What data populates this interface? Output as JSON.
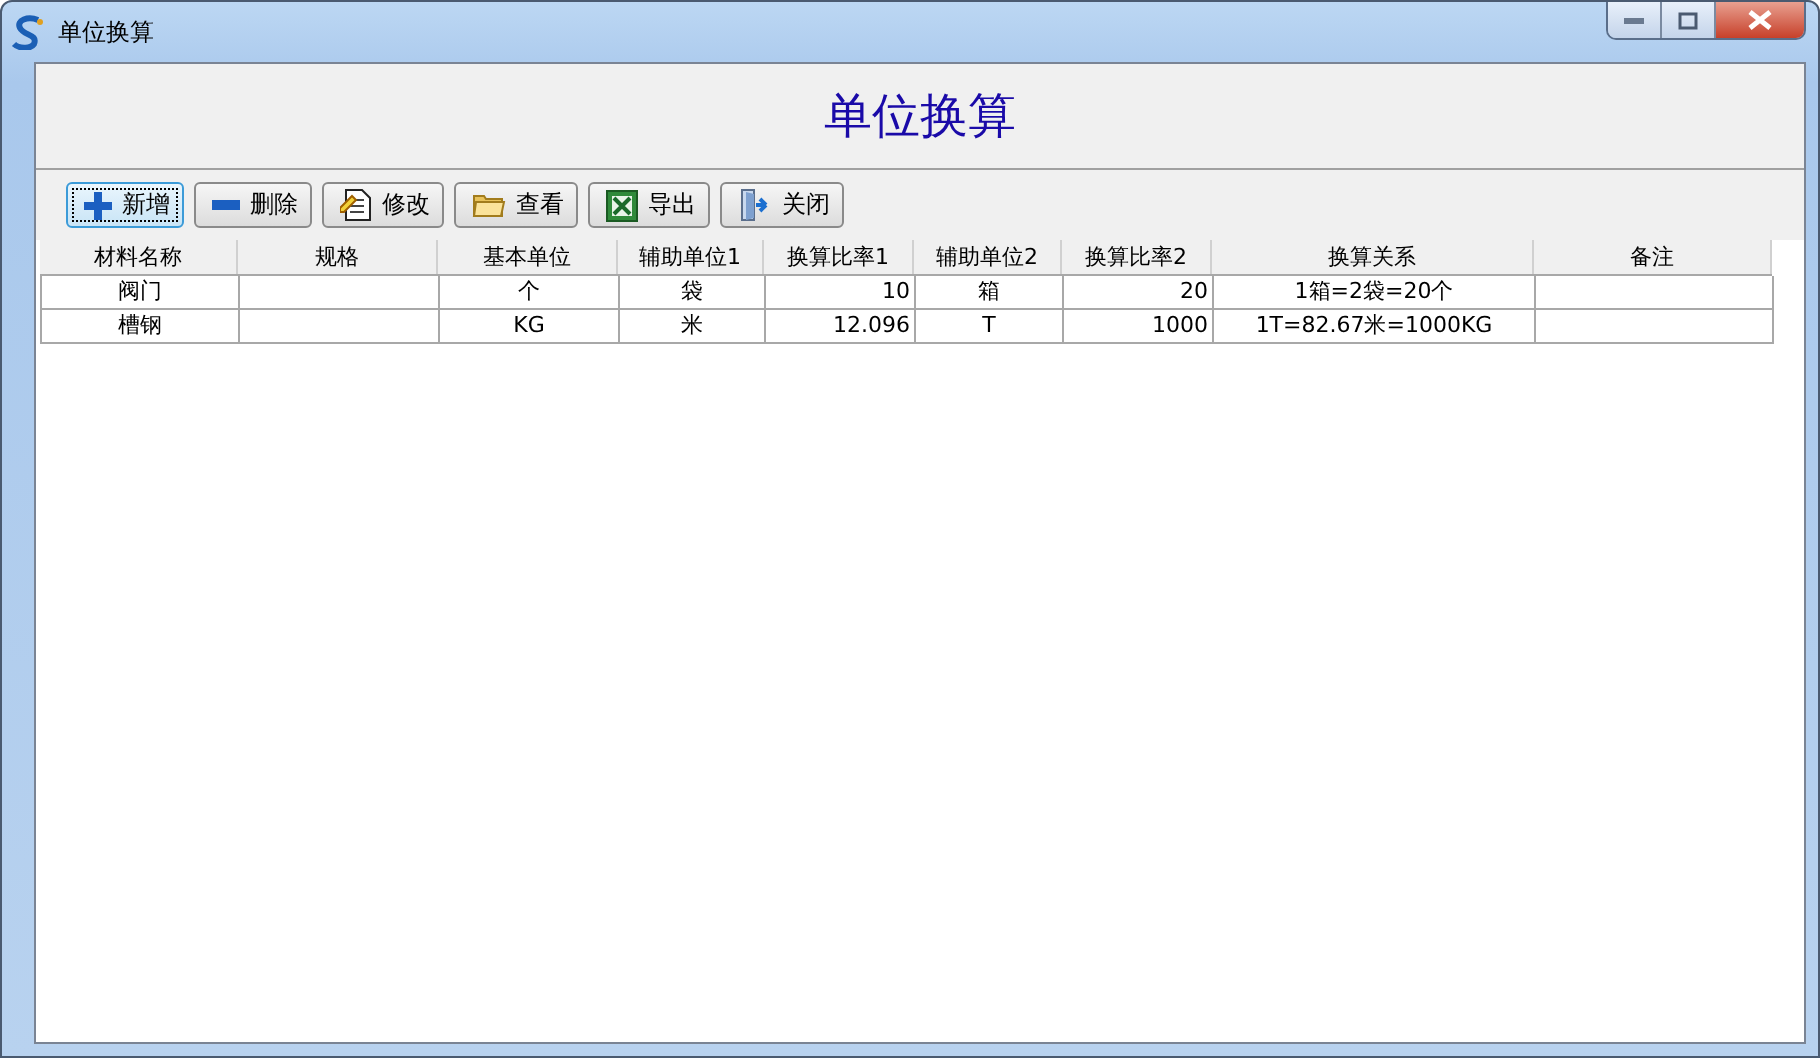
{
  "window": {
    "title": "单位换算"
  },
  "header": {
    "title": "单位换算"
  },
  "toolbar": [
    {
      "kind": "add",
      "label": "新增",
      "focused": true
    },
    {
      "kind": "remove",
      "label": "删除",
      "focused": false
    },
    {
      "kind": "edit",
      "label": "修改",
      "focused": false
    },
    {
      "kind": "view",
      "label": "查看",
      "focused": false
    },
    {
      "kind": "export",
      "label": "导出",
      "focused": false
    },
    {
      "kind": "close",
      "label": "关闭",
      "focused": false
    }
  ],
  "table": {
    "columns": [
      "材料名称",
      "规格",
      "基本单位",
      "辅助单位1",
      "换算比率1",
      "辅助单位2",
      "换算比率2",
      "换算关系",
      "备注"
    ],
    "rows": [
      [
        "阀门",
        "",
        "个",
        "袋",
        "10",
        "箱",
        "20",
        "1箱=2袋=20个",
        ""
      ],
      [
        "槽钢",
        "",
        "KG",
        "米",
        "12.096",
        "T",
        "1000",
        "1T=82.67米=1000KG",
        ""
      ]
    ]
  }
}
